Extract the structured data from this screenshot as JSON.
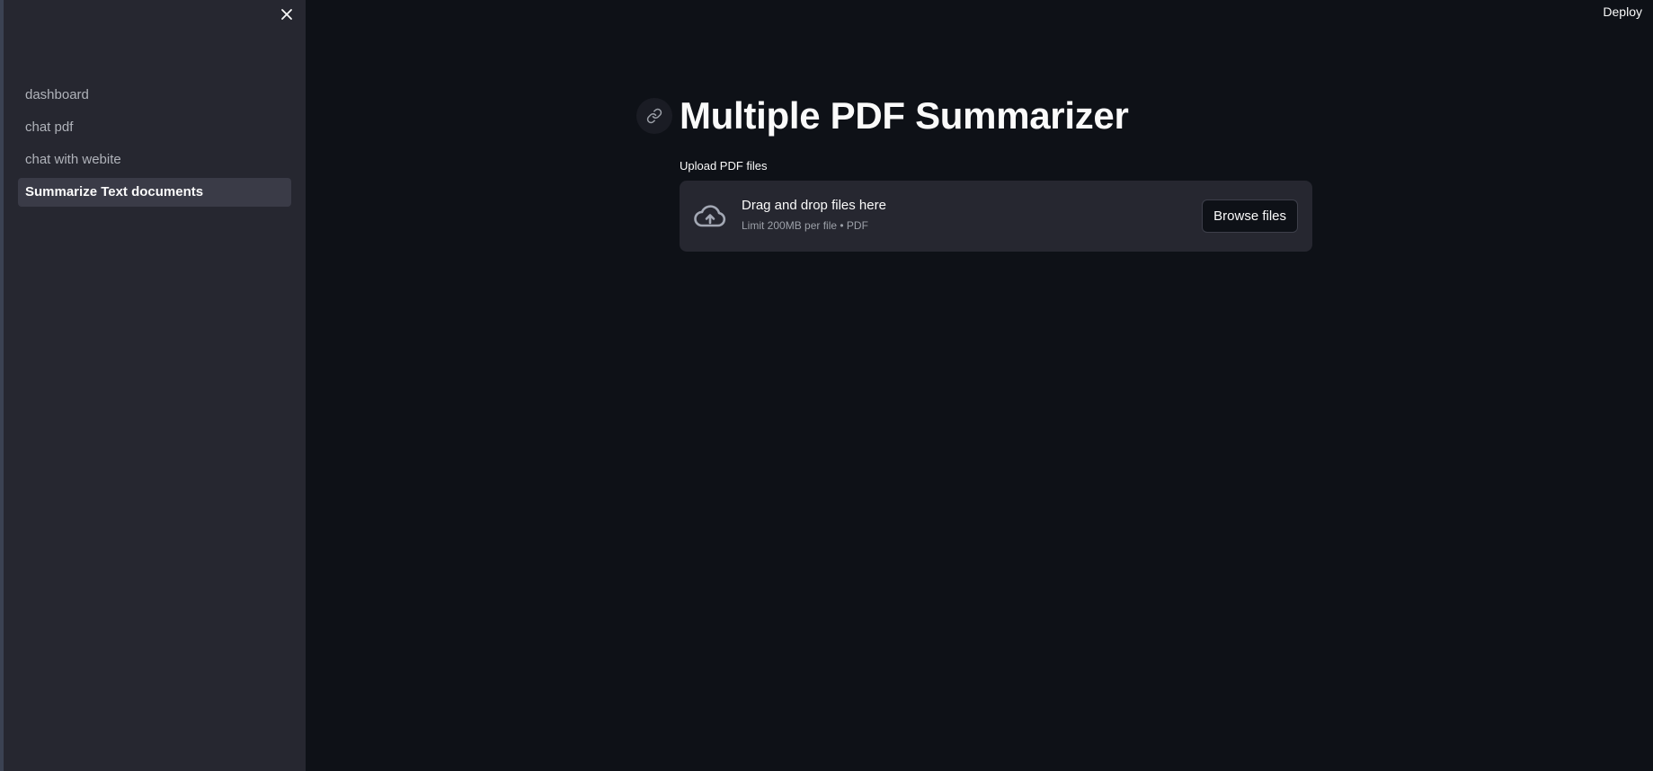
{
  "header": {
    "deploy_label": "Deploy"
  },
  "sidebar": {
    "close_icon": "close-icon",
    "items": [
      {
        "label": "dashboard",
        "active": false
      },
      {
        "label": "chat pdf",
        "active": false
      },
      {
        "label": "chat with webite",
        "active": false
      },
      {
        "label": "Summarize Text documents",
        "active": true
      }
    ]
  },
  "main": {
    "title": "Multiple PDF Summarizer",
    "title_anchor_icon": "link-icon",
    "uploader": {
      "label": "Upload PDF files",
      "icon": "cloud-upload-icon",
      "drop_text": "Drag and drop files here",
      "limit_text": "Limit 200MB per file • PDF",
      "browse_label": "Browse files"
    }
  },
  "colors": {
    "background": "#0e1117",
    "sidebar": "#262730",
    "active_item": "#3a3b47",
    "text": "#fafafa",
    "muted_text": "#9ca0a8"
  }
}
